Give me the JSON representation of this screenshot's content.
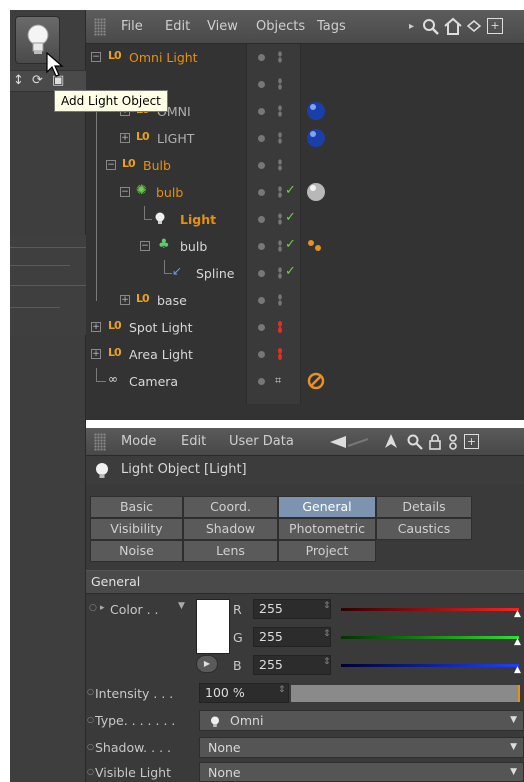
{
  "tooltip": "Add Light Object",
  "object_manager": {
    "menu": [
      "File",
      "Edit",
      "View",
      "Objects",
      "Tags"
    ],
    "objects": [
      {
        "name": "Omni Light",
        "color": "orange"
      },
      {
        "name": "OMNI",
        "color": "dim"
      },
      {
        "name": "LIGHT",
        "color": "dim"
      },
      {
        "name": "Bulb",
        "color": "orange"
      },
      {
        "name": "bulb",
        "color": "orange"
      },
      {
        "name": "Light",
        "color": "orange"
      },
      {
        "name": "bulb",
        "color": "normal"
      },
      {
        "name": "Spline",
        "color": "normal"
      },
      {
        "name": "base",
        "color": "normal"
      },
      {
        "name": "Spot Light",
        "color": "normal"
      },
      {
        "name": "Area Light",
        "color": "normal"
      },
      {
        "name": "Camera",
        "color": "normal"
      }
    ]
  },
  "attribute_manager": {
    "menu": [
      "Mode",
      "Edit",
      "User Data"
    ],
    "title": "Light Object [Light]",
    "tabs": [
      "Basic",
      "Coord.",
      "General",
      "Details",
      "Visibility",
      "Shadow",
      "Photometric",
      "Caustics",
      "Noise",
      "Lens",
      "Project"
    ],
    "selected_tab": "General",
    "section": "General",
    "color_label": "Color . .",
    "r_label": "R",
    "g_label": "G",
    "b_label": "B",
    "r": "255",
    "g": "255",
    "b": "255",
    "intensity_label": "Intensity . . .",
    "intensity": "100 %",
    "type_label": "Type. . . . . . .",
    "type": "Omni",
    "shadow_label": "Shadow. . . .",
    "shadow": "None",
    "visible_light_label": "Visible Light",
    "visible_light": "None"
  },
  "colors": {
    "accent_orange": "#e8900a",
    "selected_tab": "#7d94b0"
  }
}
